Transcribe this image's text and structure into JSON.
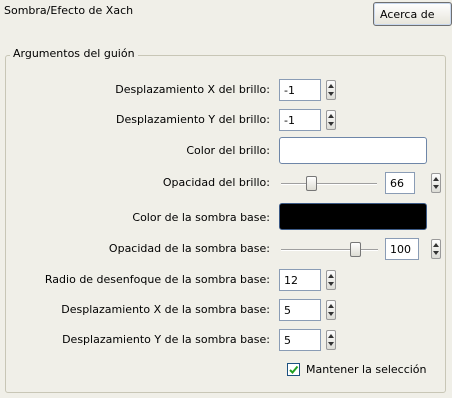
{
  "title": "Sombra/Efecto de Xach",
  "about_button": "Acerca de",
  "group_title": "Argumentos del guión",
  "fields": {
    "glow_x": {
      "label": "Desplazamiento X del brillo:",
      "value": "-1"
    },
    "glow_y": {
      "label": "Desplazamiento Y del brillo:",
      "value": "-1"
    },
    "glow_color": {
      "label": "Color del brillo:",
      "color": "#ffffff"
    },
    "glow_opacity": {
      "label": "Opacidad del brillo:",
      "value": "66",
      "level": 0.66
    },
    "shadow_color": {
      "label": "Color de la sombra base:",
      "color": "#000000"
    },
    "shadow_opacity": {
      "label": "Opacidad de la sombra base:",
      "value": "100",
      "level": 1.0
    },
    "blur_radius": {
      "label": "Radio de desenfoque de la sombra base:",
      "value": "12"
    },
    "shadow_x": {
      "label": "Desplazamiento X de la sombra base:",
      "value": "5"
    },
    "shadow_y": {
      "label": "Desplazamiento Y de la sombra base:",
      "value": "5"
    }
  },
  "keep_selection": {
    "label": "Mantener la selección",
    "checked": true
  },
  "colors": {
    "window_bg": "#f0efe8",
    "border": "#c8c6b6",
    "check": "#21a121"
  },
  "icons": {
    "spin": "up-down-arrows-icon",
    "check": "checkmark-icon"
  }
}
